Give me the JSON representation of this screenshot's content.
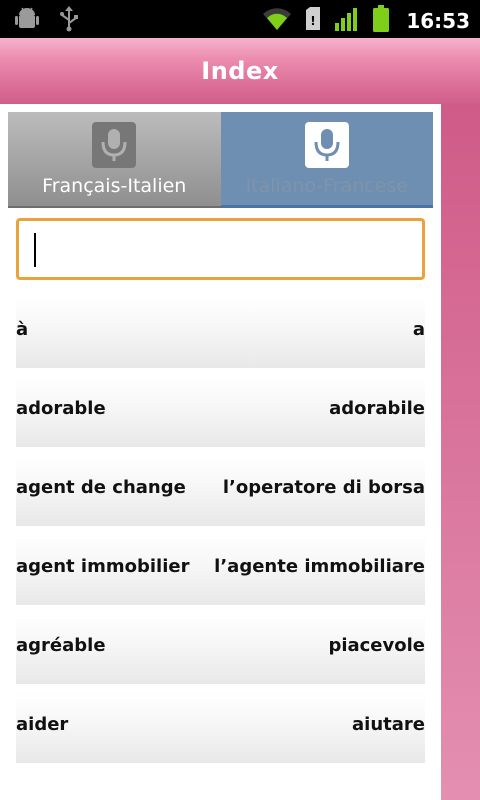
{
  "status_bar": {
    "time": "16:53",
    "icons": [
      "android-debug-icon",
      "usb-icon",
      "wifi-icon",
      "sd-card-icon",
      "signal-icon",
      "battery-icon"
    ],
    "colors": {
      "signal": "#7fcf1a",
      "battery": "#7fcf1a"
    }
  },
  "header": {
    "title": "Index"
  },
  "tabs": [
    {
      "label": "Français-Italien",
      "icon": "microphone-icon",
      "active": false
    },
    {
      "label": "Italiano-Francese",
      "icon": "microphone-icon",
      "active": true
    }
  ],
  "search": {
    "value": "",
    "placeholder": ""
  },
  "entries": [
    {
      "fr": "à",
      "it": "a"
    },
    {
      "fr": "adorable",
      "it": "adorabile"
    },
    {
      "fr": "agent de change",
      "it": "l’operatore di borsa"
    },
    {
      "fr": "agent immobilier",
      "it": "l’agente immobiliare"
    },
    {
      "fr": "agréable",
      "it": "piacevole"
    },
    {
      "fr": "aider",
      "it": "aiutare"
    }
  ],
  "colors": {
    "accent_pink": "#dc6f98",
    "search_border": "#eaa33a",
    "active_tab": "#6e8fb2"
  }
}
